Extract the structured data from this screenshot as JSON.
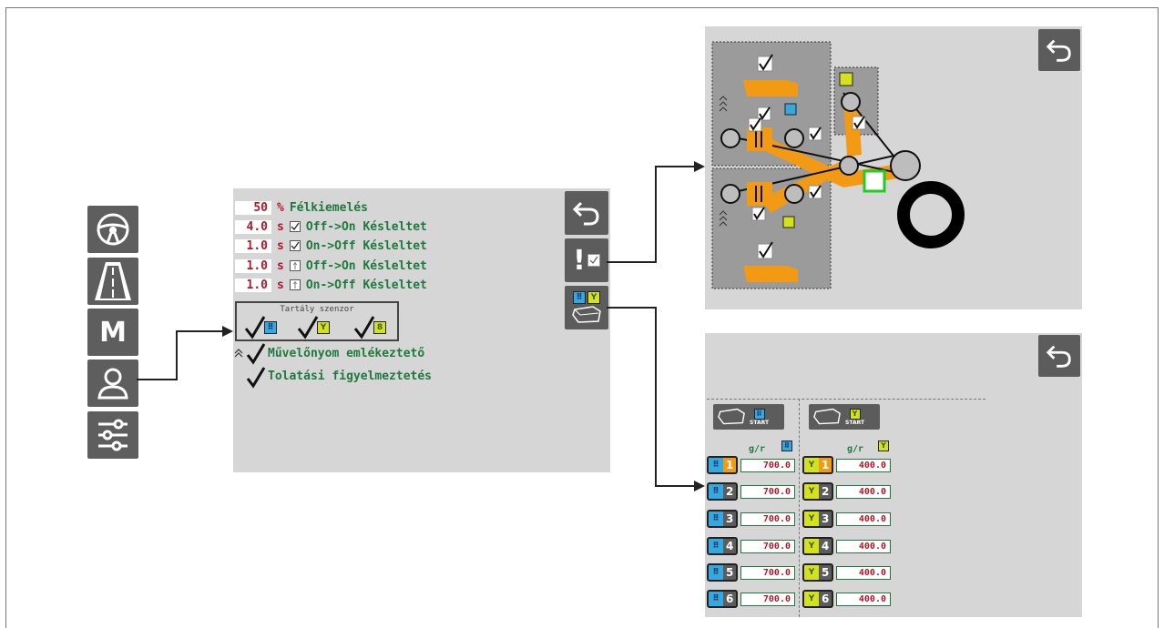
{
  "main_panel": {
    "rows": [
      {
        "value": "50",
        "unit": "%",
        "checkbox": "none",
        "label": "Félkiemelés"
      },
      {
        "value": "4.0",
        "unit": "s",
        "checkbox": "checked",
        "label": "Off->On Késleltet"
      },
      {
        "value": "1.0",
        "unit": "s",
        "checkbox": "checked",
        "label": "On->Off Késleltet"
      },
      {
        "value": "1.0",
        "unit": "s",
        "checkbox": "partial",
        "label": "Off->On Késleltet"
      },
      {
        "value": "1.0",
        "unit": "s",
        "checkbox": "partial",
        "label": "On->Off Késleltet"
      }
    ],
    "sensor_title": "Tartály szenzor",
    "options": [
      {
        "label": "Művelőnyom emlékeztető",
        "checked": true
      },
      {
        "label": "Tolatási figyelmeztetés",
        "checked": true
      }
    ]
  },
  "left_menu": {
    "items": [
      "steering-wheel-icon",
      "road-icon",
      "m-icon",
      "user-icon",
      "sliders-icon"
    ],
    "m_label": "M"
  },
  "dose_panel": {
    "start_label": "START",
    "unit_label": "g/r",
    "left_rows": [
      {
        "num": "1",
        "value": "700.0"
      },
      {
        "num": "2",
        "value": "700.0"
      },
      {
        "num": "3",
        "value": "700.0"
      },
      {
        "num": "4",
        "value": "700.0"
      },
      {
        "num": "5",
        "value": "700.0"
      },
      {
        "num": "6",
        "value": "700.0"
      }
    ],
    "right_rows": [
      {
        "num": "1",
        "value": "400.0"
      },
      {
        "num": "2",
        "value": "400.0"
      },
      {
        "num": "3",
        "value": "400.0"
      },
      {
        "num": "4",
        "value": "400.0"
      },
      {
        "num": "5",
        "value": "400.0"
      },
      {
        "num": "6",
        "value": "400.0"
      }
    ]
  },
  "colors": {
    "panel_bg": "#d6d6d6",
    "button_bg": "#5c5c5c",
    "label_green": "#1e7a3c",
    "value_red": "#b5172a",
    "orange": "#f39a14",
    "blue_icon": "#35a8e0",
    "yellow_icon": "#d4e21b"
  }
}
